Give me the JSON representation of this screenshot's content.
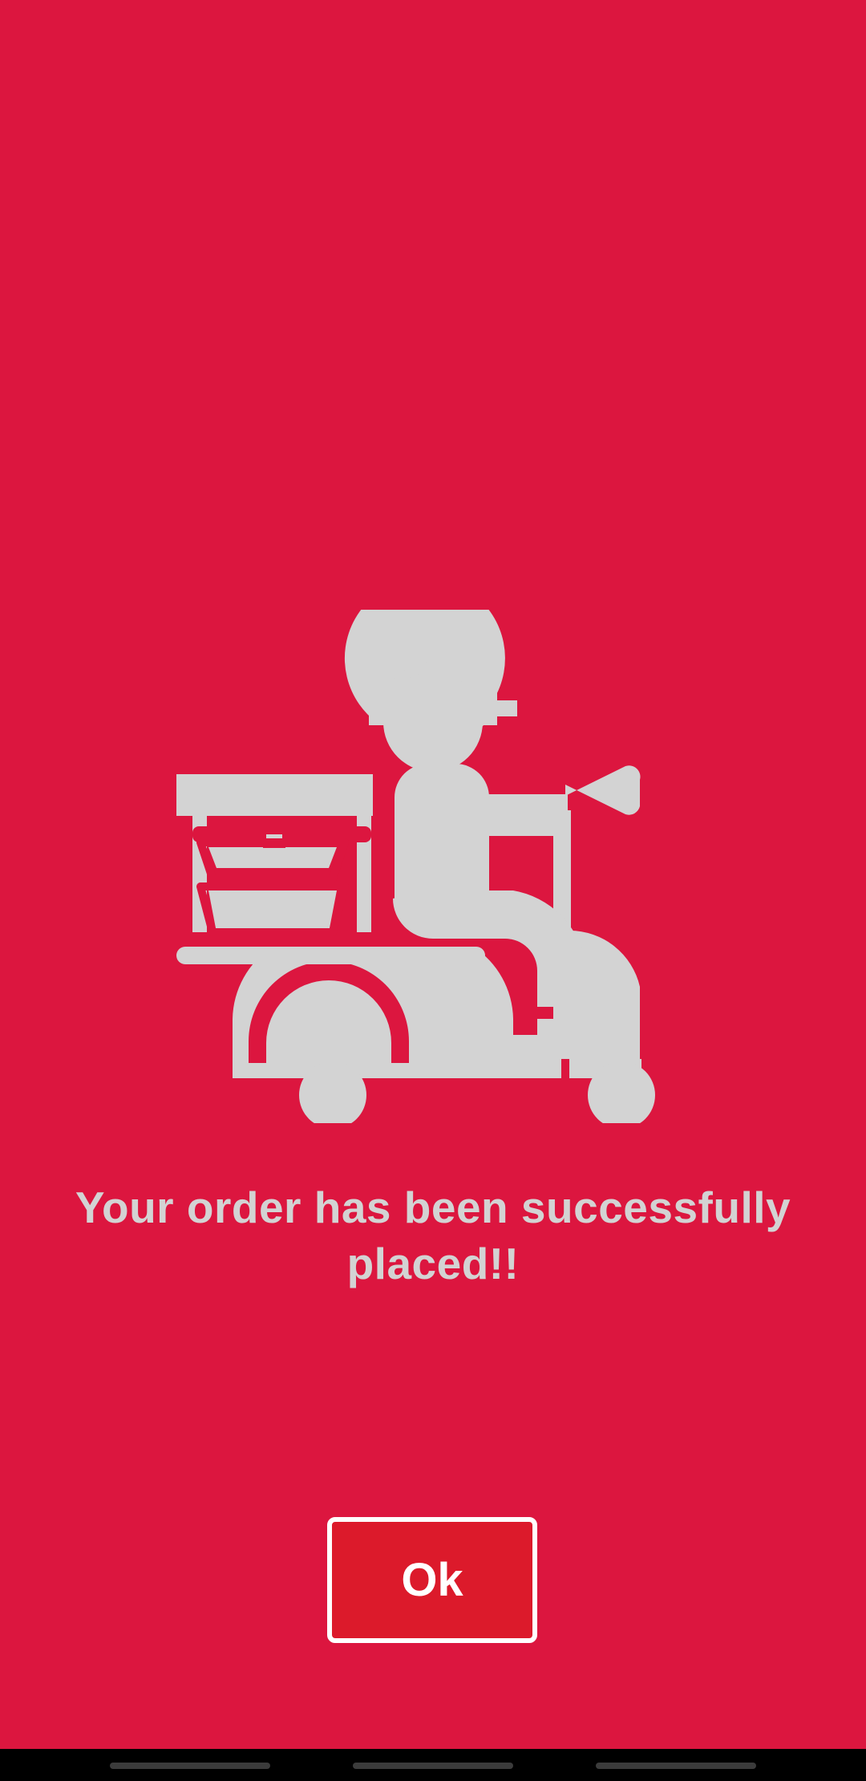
{
  "confirmation": {
    "message": "Your order has been successfully placed!!",
    "illustration_icon": "delivery-scooter-icon"
  },
  "actions": {
    "ok_label": "Ok"
  },
  "colors": {
    "background": "#DC163F",
    "illustration": "#D3D3D3",
    "button_fill": "#DC1A2B",
    "button_border": "#FFFFFF"
  }
}
